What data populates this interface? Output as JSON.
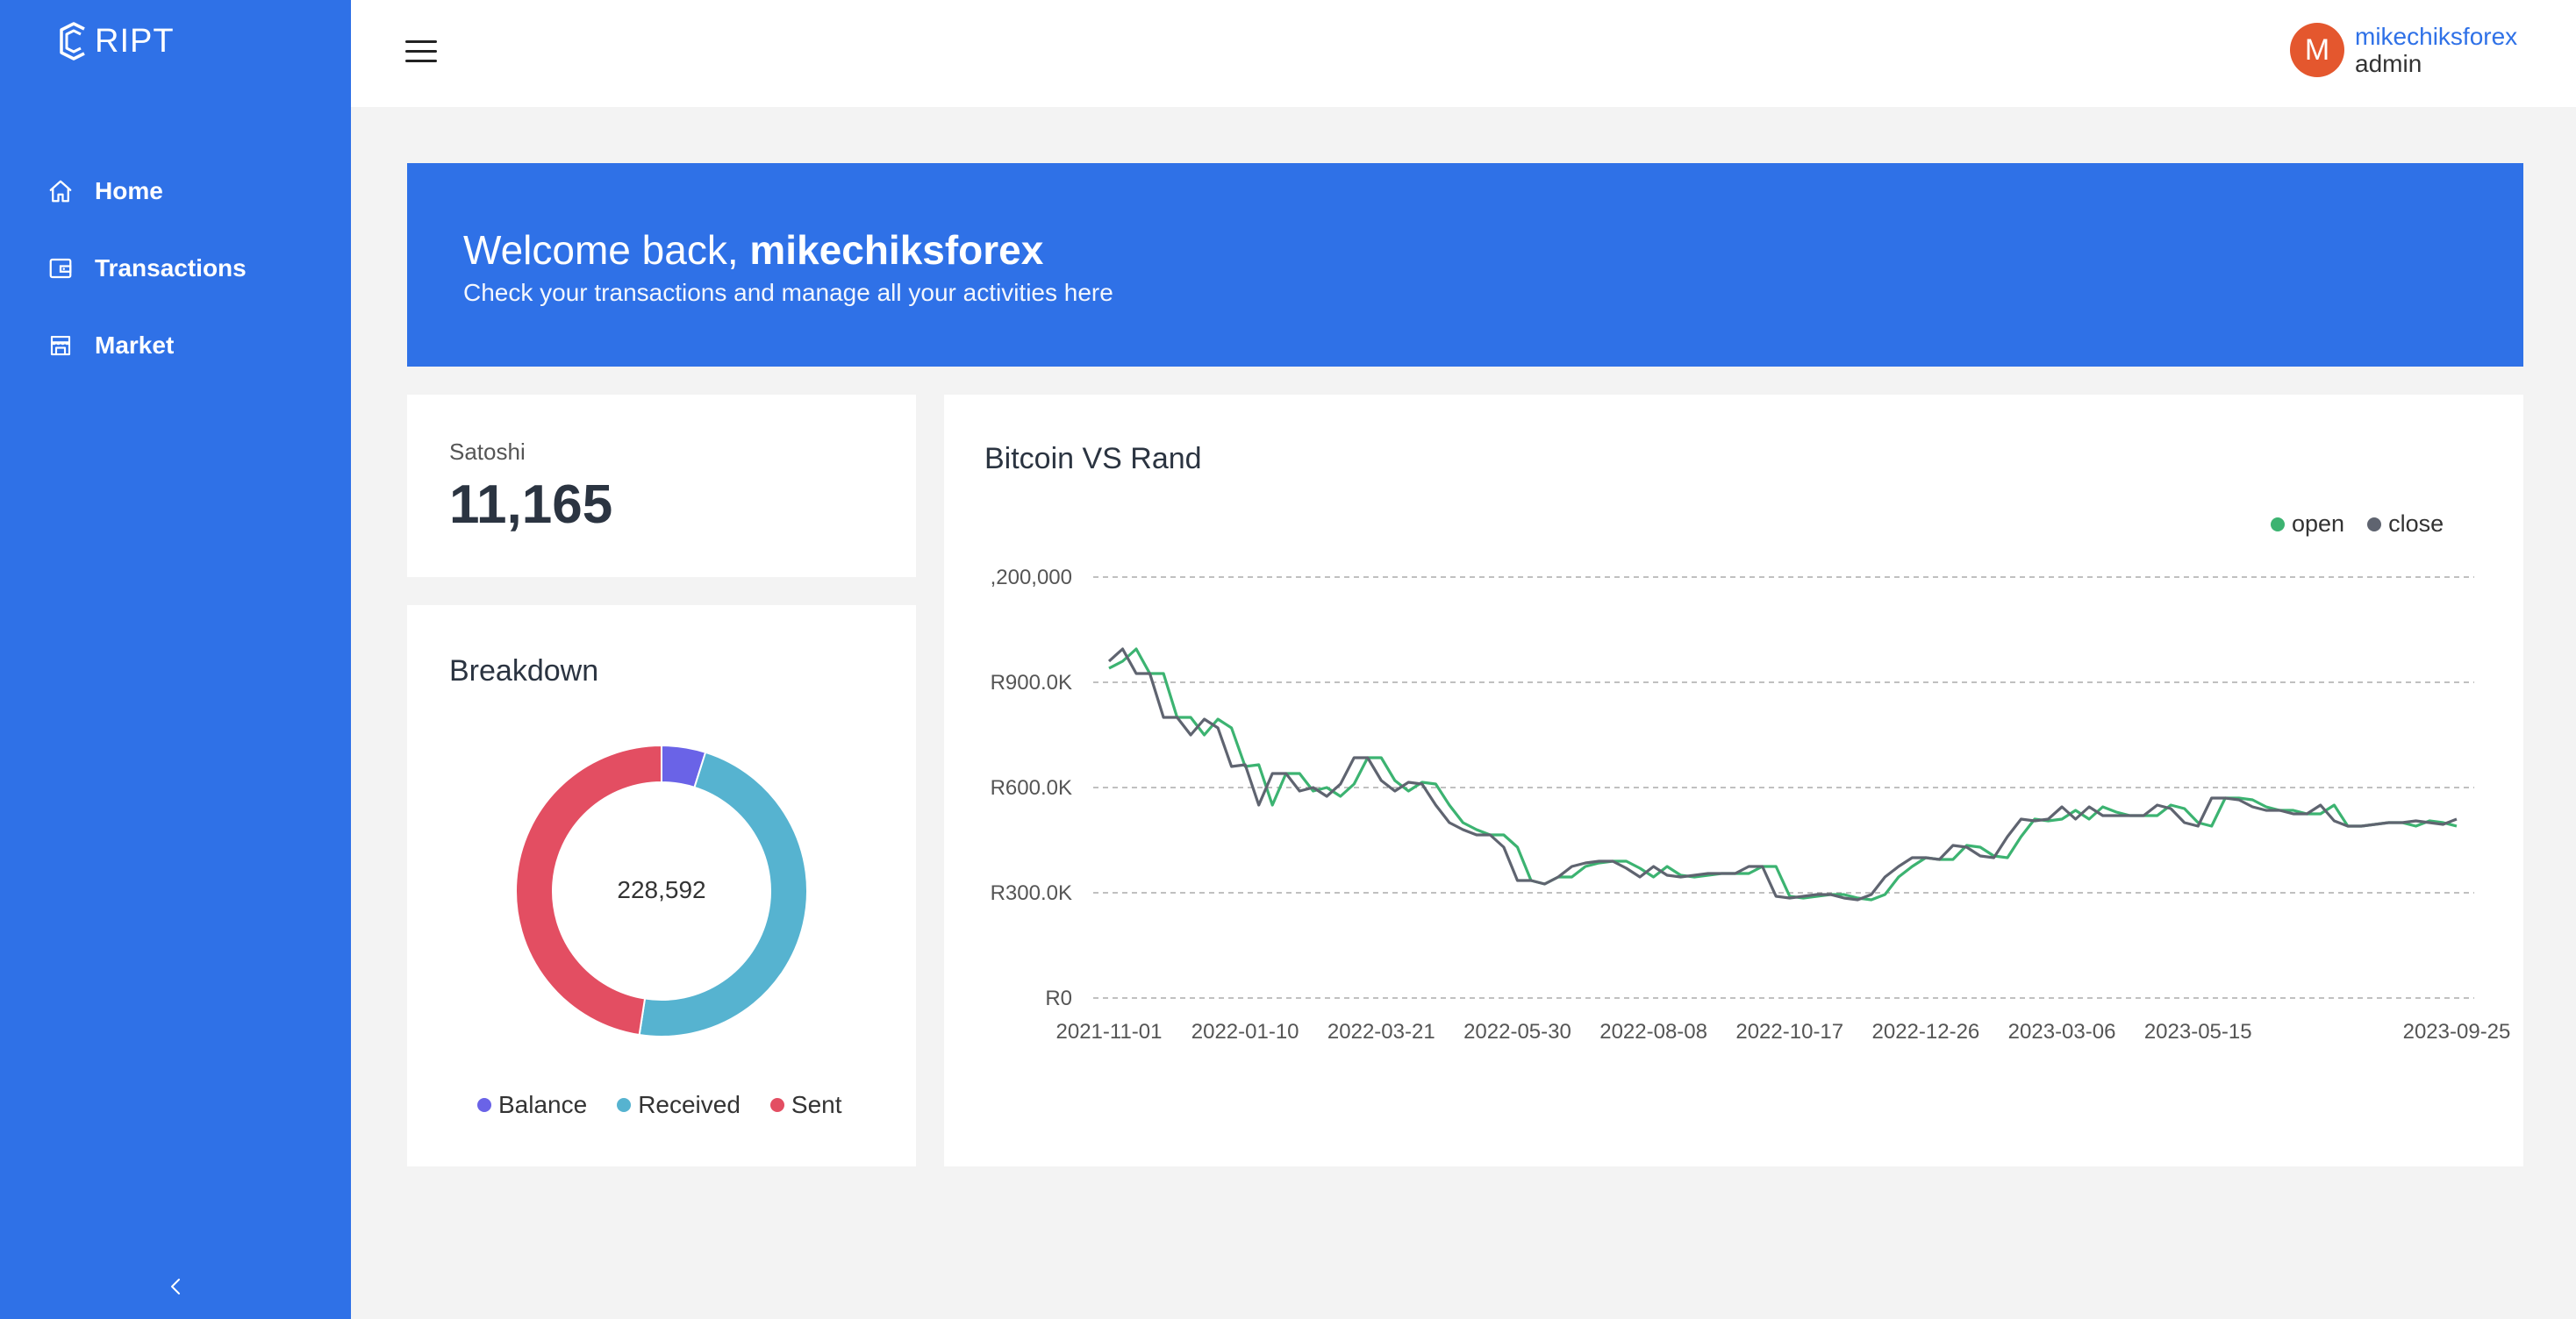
{
  "app": {
    "logo_text": "RIPT"
  },
  "sidebar": {
    "items": [
      {
        "label": "Home",
        "icon": "home-icon"
      },
      {
        "label": "Transactions",
        "icon": "wallet-icon"
      },
      {
        "label": "Market",
        "icon": "store-icon"
      }
    ]
  },
  "user": {
    "initial": "M",
    "name": "mikechiksforex",
    "role": "admin"
  },
  "banner": {
    "greeting": "Welcome back, ",
    "username": "mikechiksforex",
    "subtitle": "Check your transactions and manage all your activities here"
  },
  "balance_card": {
    "label": "Satoshi",
    "value": "11,165"
  },
  "breakdown": {
    "title": "Breakdown",
    "center_value": "228,592",
    "legend": [
      {
        "label": "Balance",
        "color": "#6a63e7"
      },
      {
        "label": "Received",
        "color": "#56b3d0"
      },
      {
        "label": "Sent",
        "color": "#e34e62"
      }
    ]
  },
  "price_chart": {
    "title": "Bitcoin VS Rand",
    "legend": [
      {
        "label": "open",
        "color": "#3cb371"
      },
      {
        "label": "close",
        "color": "#5f6470"
      }
    ]
  },
  "chart_data": [
    {
      "type": "pie",
      "title": "Breakdown",
      "categories": [
        "Balance",
        "Received",
        "Sent"
      ],
      "values": [
        11165,
        108714,
        108713
      ],
      "total_label": "228,592",
      "colors": [
        "#6a63e7",
        "#56b3d0",
        "#e34e62"
      ]
    },
    {
      "type": "line",
      "title": "Bitcoin VS Rand",
      "ylim": [
        0,
        1200000
      ],
      "y_ticks": [
        {
          "value": 0,
          "label": "R0"
        },
        {
          "value": 300000,
          "label": "R300.0K"
        },
        {
          "value": 600000,
          "label": "R600.0K"
        },
        {
          "value": 900000,
          "label": "R900.0K"
        },
        {
          "value": 1200000,
          "label": ",200,000"
        }
      ],
      "x_ticks": [
        {
          "i": 0,
          "label": "2021-11-01"
        },
        {
          "i": 10,
          "label": "2022-01-10"
        },
        {
          "i": 20,
          "label": "2022-03-21"
        },
        {
          "i": 30,
          "label": "2022-05-30"
        },
        {
          "i": 40,
          "label": "2022-08-08"
        },
        {
          "i": 50,
          "label": "2022-10-17"
        },
        {
          "i": 60,
          "label": "2022-12-26"
        },
        {
          "i": 70,
          "label": "2023-03-06"
        },
        {
          "i": 80,
          "label": "2023-05-15"
        },
        {
          "i": 99,
          "label": "2023-09-25"
        }
      ],
      "series": [
        {
          "name": "open",
          "color": "#3cb371",
          "values": [
            940000,
            960000,
            995000,
            925000,
            925000,
            800000,
            800000,
            750000,
            795000,
            770000,
            660000,
            665000,
            550000,
            640000,
            640000,
            590000,
            600000,
            575000,
            610000,
            685000,
            685000,
            620000,
            590000,
            615000,
            610000,
            550000,
            500000,
            480000,
            465000,
            465000,
            430000,
            335000,
            325000,
            345000,
            345000,
            375000,
            385000,
            390000,
            390000,
            370000,
            345000,
            375000,
            350000,
            345000,
            350000,
            355000,
            355000,
            355000,
            375000,
            375000,
            290000,
            285000,
            290000,
            295000,
            295000,
            285000,
            280000,
            295000,
            345000,
            375000,
            400000,
            395000,
            395000,
            435000,
            430000,
            405000,
            400000,
            460000,
            510000,
            505000,
            510000,
            535000,
            510000,
            545000,
            530000,
            520000,
            520000,
            520000,
            550000,
            540000,
            500000,
            490000,
            570000,
            570000,
            565000,
            545000,
            535000,
            535000,
            525000,
            525000,
            550000,
            490000,
            490000,
            495000,
            500000,
            500000,
            490000,
            505000,
            500000,
            490000
          ]
        },
        {
          "name": "close",
          "color": "#5f6470",
          "values": [
            960000,
            995000,
            925000,
            925000,
            800000,
            800000,
            750000,
            795000,
            770000,
            660000,
            665000,
            550000,
            640000,
            640000,
            590000,
            600000,
            575000,
            610000,
            685000,
            685000,
            620000,
            590000,
            615000,
            610000,
            550000,
            500000,
            480000,
            465000,
            465000,
            430000,
            335000,
            335000,
            325000,
            345000,
            375000,
            385000,
            390000,
            390000,
            370000,
            345000,
            375000,
            350000,
            345000,
            350000,
            355000,
            355000,
            355000,
            375000,
            375000,
            290000,
            285000,
            290000,
            295000,
            295000,
            285000,
            280000,
            295000,
            345000,
            375000,
            400000,
            400000,
            395000,
            435000,
            430000,
            405000,
            400000,
            460000,
            510000,
            505000,
            510000,
            545000,
            510000,
            545000,
            520000,
            520000,
            520000,
            520000,
            550000,
            540000,
            500000,
            490000,
            570000,
            570000,
            565000,
            545000,
            535000,
            535000,
            525000,
            525000,
            550000,
            505000,
            490000,
            490000,
            495000,
            500000,
            500000,
            505000,
            500000,
            495000,
            510000
          ]
        }
      ]
    }
  ]
}
